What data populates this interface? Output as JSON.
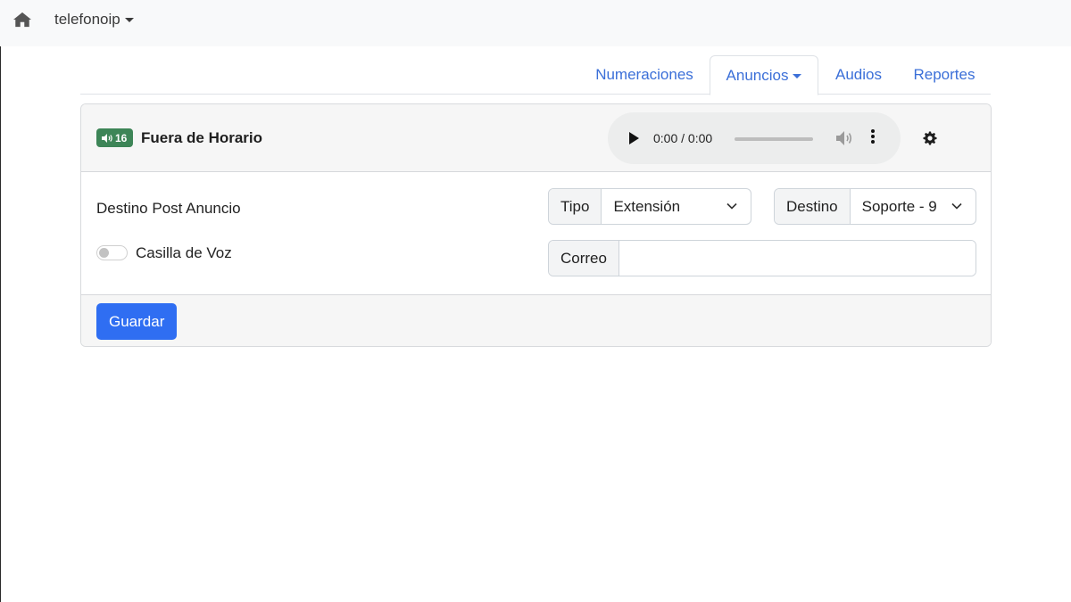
{
  "navbar": {
    "home_icon": "home-icon",
    "brand_label": "telefonoip"
  },
  "tabs": [
    {
      "label": "Numeraciones",
      "active": false
    },
    {
      "label": "Anuncios",
      "active": true,
      "dropdown": true
    },
    {
      "label": "Audios",
      "active": false
    },
    {
      "label": "Reportes",
      "active": false
    }
  ],
  "card": {
    "badge_count": "16",
    "badge_icon": "volume-icon",
    "title": "Fuera de Horario",
    "player": {
      "time": "0:00 / 0:00",
      "progress": 0
    },
    "settings_icon": "gear-icon",
    "destino_label": "Destino Post Anuncio",
    "tipo": {
      "addon": "Tipo",
      "value": "Extensión"
    },
    "destino": {
      "addon": "Destino",
      "value": "Soporte - 9"
    },
    "casilla_label": "Casilla de Voz",
    "casilla_enabled": false,
    "correo": {
      "addon": "Correo",
      "value": ""
    },
    "save_label": "Guardar"
  },
  "colors": {
    "accent": "#2f6ef2",
    "link": "#3b6fd8",
    "badge": "#3d8557"
  }
}
